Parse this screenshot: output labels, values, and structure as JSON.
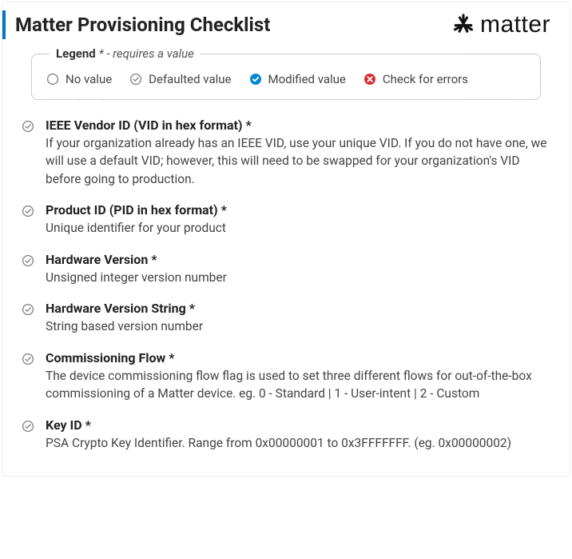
{
  "header": {
    "title": "Matter Provisioning Checklist",
    "brand": "matter"
  },
  "legend": {
    "label": "Legend",
    "required_hint": "* - requires a value",
    "items": [
      {
        "icon": "circle-empty",
        "text": "No value"
      },
      {
        "icon": "circle-check-grey",
        "text": "Defaulted value"
      },
      {
        "icon": "circle-check-blue",
        "text": "Modified value"
      },
      {
        "icon": "circle-x-red",
        "text": "Check for errors"
      }
    ]
  },
  "checklist": [
    {
      "status": "defaulted",
      "title": "IEEE Vendor ID (VID in hex format) *",
      "desc": "If your organization already has an IEEE VID, use your unique VID. If you do not have one, we will use a default VID; however, this will need to be swapped for your organization's VID before going to production."
    },
    {
      "status": "defaulted",
      "title": "Product ID (PID in hex format) *",
      "desc": "Unique identifier for your product"
    },
    {
      "status": "defaulted",
      "title": "Hardware Version *",
      "desc": "Unsigned integer version number"
    },
    {
      "status": "defaulted",
      "title": "Hardware Version String *",
      "desc": "String based version number"
    },
    {
      "status": "defaulted",
      "title": "Commissioning Flow *",
      "desc": "The device commissioning flow flag is used to set three different flows for out-of-the-box commissioning of a Matter device. eg. 0 - Standard | 1 - User-intent | 2 - Custom"
    },
    {
      "status": "defaulted",
      "title": "Key ID *",
      "desc": "PSA Crypto Key Identifier. Range from 0x00000001 to 0x3FFFFFFF. (eg. 0x00000002)"
    }
  ]
}
